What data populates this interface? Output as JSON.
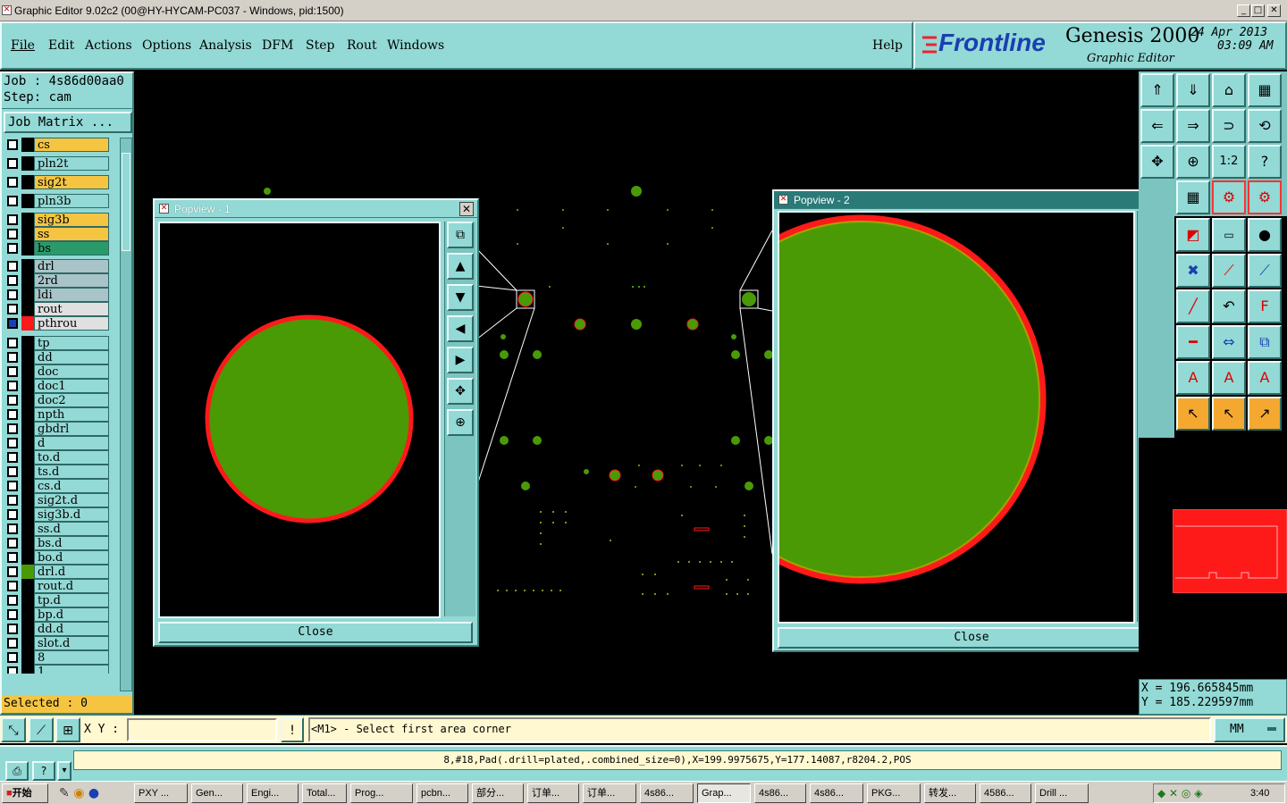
{
  "window": {
    "title": "Graphic Editor 9.02c2 (00@HY-HYCAM-PC037 - Windows, pid:1500)"
  },
  "menu": {
    "items": [
      "File",
      "Edit",
      "Actions",
      "Options",
      "Analysis",
      "DFM",
      "Step",
      "Rout",
      "Windows"
    ],
    "help": "Help"
  },
  "brand": {
    "logo": "Frontline",
    "product": "Genesis 2000",
    "subtitle": "Graphic Editor",
    "date": "24 Apr 2013",
    "time": "03:09 AM"
  },
  "job": {
    "job_label": "Job : 4s86d00aa0",
    "step_label": "Step: cam",
    "matrix_button": "Job Matrix ..."
  },
  "layers": [
    {
      "name": "cs",
      "color": "#f5c542"
    },
    {
      "name": "pln2t",
      "color": "#93d9d5"
    },
    {
      "name": "sig2t",
      "color": "#f5c542"
    },
    {
      "name": "pln3b",
      "color": "#93d9d5"
    },
    {
      "name": "sig3b",
      "color": "#f5c542"
    },
    {
      "name": "ss",
      "color": "#f5c542"
    },
    {
      "name": "bs",
      "color": "#2a9a6a"
    },
    {
      "name": "drl",
      "color": "#a8c4c8"
    },
    {
      "name": "2rd",
      "color": "#a8c4c8"
    },
    {
      "name": "ldi",
      "color": "#a8c4c8"
    },
    {
      "name": "rout",
      "color": "#e0e0e0"
    },
    {
      "name": "pthrou",
      "color": "#e0e0e0"
    },
    {
      "name": "tp",
      "color": "#93d9d5"
    },
    {
      "name": "dd",
      "color": "#93d9d5"
    },
    {
      "name": "doc",
      "color": "#93d9d5"
    },
    {
      "name": "doc1",
      "color": "#93d9d5"
    },
    {
      "name": "doc2",
      "color": "#93d9d5"
    },
    {
      "name": "npth",
      "color": "#93d9d5"
    },
    {
      "name": "gbdrl",
      "color": "#93d9d5"
    },
    {
      "name": "d",
      "color": "#93d9d5"
    },
    {
      "name": "to.d",
      "color": "#93d9d5"
    },
    {
      "name": "ts.d",
      "color": "#93d9d5"
    },
    {
      "name": "cs.d",
      "color": "#93d9d5"
    },
    {
      "name": "sig2t.d",
      "color": "#93d9d5"
    },
    {
      "name": "sig3b.d",
      "color": "#93d9d5"
    },
    {
      "name": "ss.d",
      "color": "#93d9d5"
    },
    {
      "name": "bs.d",
      "color": "#93d9d5"
    },
    {
      "name": "bo.d",
      "color": "#93d9d5"
    },
    {
      "name": "drl.d",
      "color": "#93d9d5"
    },
    {
      "name": "rout.d",
      "color": "#93d9d5"
    },
    {
      "name": "tp.d",
      "color": "#93d9d5"
    },
    {
      "name": "bp.d",
      "color": "#93d9d5"
    },
    {
      "name": "dd.d",
      "color": "#93d9d5"
    },
    {
      "name": "slot.d",
      "color": "#93d9d5"
    },
    {
      "name": "8",
      "color": "#93d9d5"
    },
    {
      "name": "1",
      "color": "#93d9d5"
    }
  ],
  "selected": "Selected : 0",
  "popview1": {
    "title": "Popview - 1",
    "close": "Close"
  },
  "popview2": {
    "title": "Popview - 2",
    "close": "Close"
  },
  "coords": {
    "x": "X = 196.665845mm",
    "y": "Y = 185.229597mm"
  },
  "bottom": {
    "xy_label": "X Y :",
    "xy_value": "",
    "prompt": "<M1> - Select first area corner",
    "units": "MM",
    "info": "8,#18,Pad(.drill=plated,.combined_size=0),X=199.9975675,Y=177.14087,r8204.2,POS"
  },
  "colors": {
    "panel": "#93d9d5",
    "pad_fill": "#4a9a06",
    "pad_edge": "#ff1a1a",
    "selected_bar": "#f5c542"
  },
  "taskbar": {
    "start": "开始",
    "tasks": [
      "PXY ...",
      "Gen...",
      "Engi...",
      "Total...",
      "Prog...",
      "pcbn...",
      "部分...",
      "订单...",
      "订单...",
      "4s86...",
      "Grap...",
      "4s86...",
      "4s86...",
      "PKG...",
      "转发...",
      "4586...",
      "Drill ..."
    ],
    "clock": "3:40"
  }
}
